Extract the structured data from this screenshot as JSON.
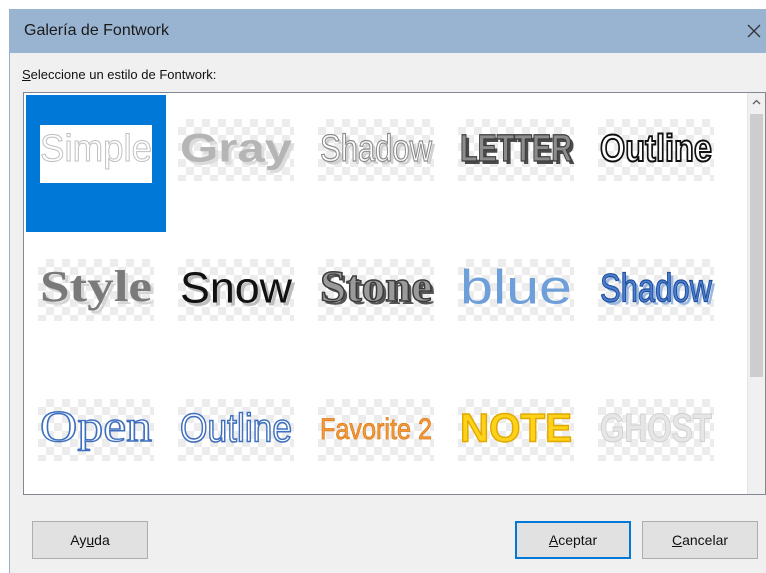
{
  "window": {
    "title": "Galería de Fontwork",
    "close_icon": "close-icon"
  },
  "prompt": {
    "label_pre": "",
    "label_u": "S",
    "label_post": "eleccione un estilo de Fontwork:"
  },
  "gallery": {
    "selected_index": 0,
    "items": [
      {
        "label": "Simple",
        "style": "simple"
      },
      {
        "label": "Gray",
        "style": "gray"
      },
      {
        "label": "Shadow",
        "style": "shadow-gray"
      },
      {
        "label": "LETTER",
        "style": "letter"
      },
      {
        "label": "Outline",
        "style": "outline-black"
      },
      {
        "label": "Style",
        "style": "style-serif"
      },
      {
        "label": "Snow",
        "style": "snow"
      },
      {
        "label": "Stone",
        "style": "stone"
      },
      {
        "label": "blue",
        "style": "blue"
      },
      {
        "label": "Shadow",
        "style": "shadow-blue"
      },
      {
        "label": "Open",
        "style": "open"
      },
      {
        "label": "Outline",
        "style": "outline-blue"
      },
      {
        "label": "Favorite 2",
        "style": "favorite"
      },
      {
        "label": "NOTE",
        "style": "note"
      },
      {
        "label": "GHOST",
        "style": "ghost"
      }
    ]
  },
  "buttons": {
    "help_pre": "Ay",
    "help_u": "u",
    "help_post": "da",
    "ok_pre": "",
    "ok_u": "A",
    "ok_post": "ceptar",
    "cancel_pre": "",
    "cancel_u": "C",
    "cancel_post": "ancelar"
  },
  "colors": {
    "titlebar": "#99b4d1",
    "selection": "#0078d7",
    "dialog_bg": "#f0f0f0"
  }
}
